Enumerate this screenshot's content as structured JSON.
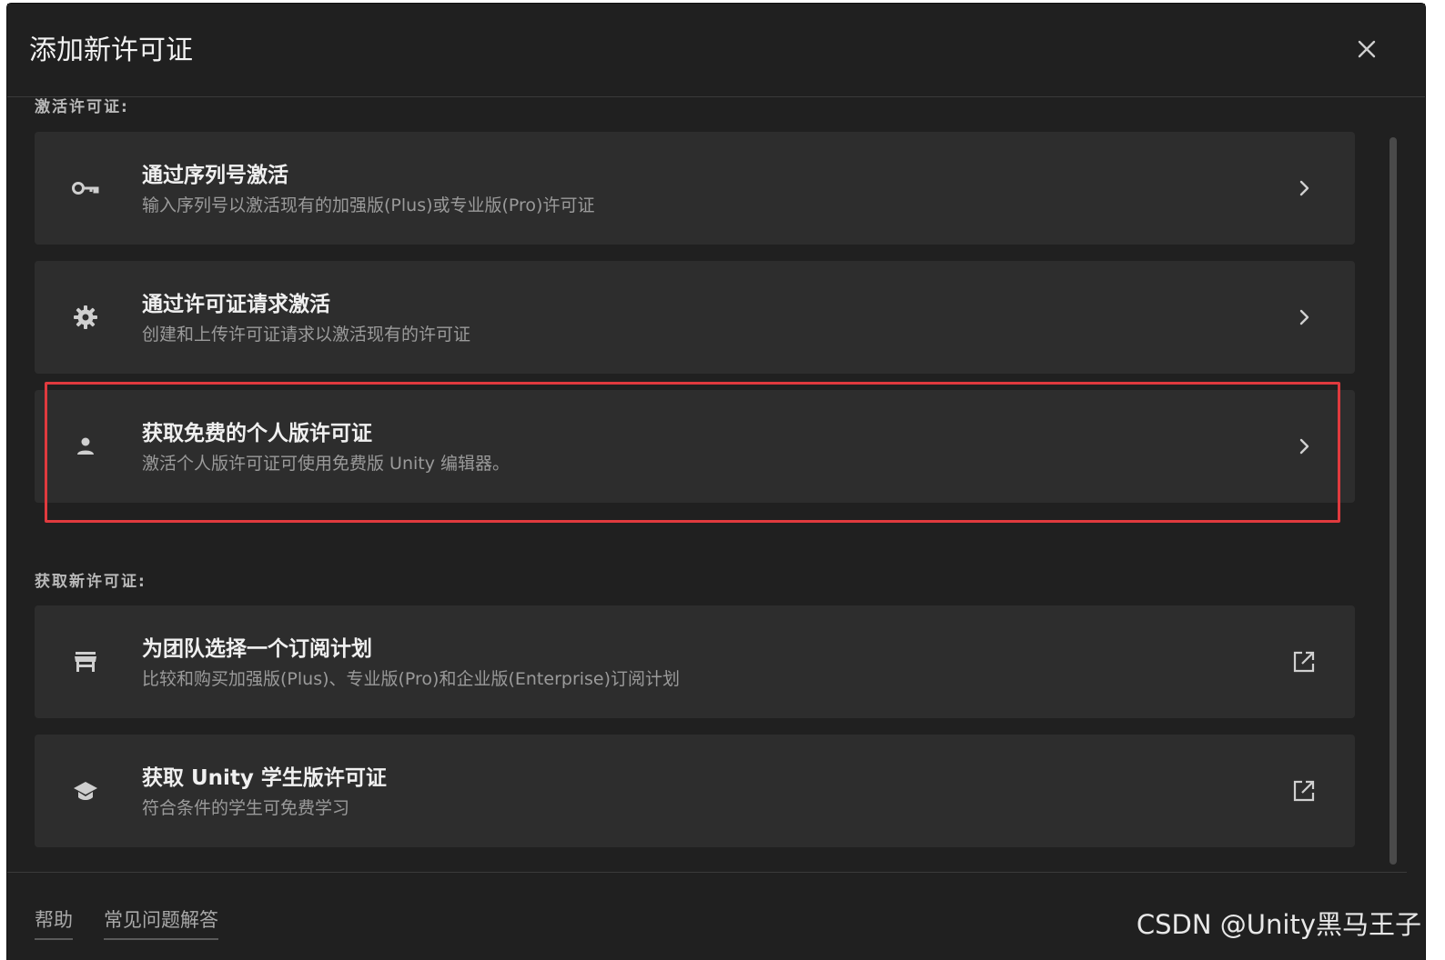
{
  "dialog": {
    "title": "添加新许可证",
    "close_icon": "close-icon"
  },
  "sections": {
    "activate_label": "激活许可证:",
    "new_label": "获取新许可证:"
  },
  "cards": [
    {
      "icon": "key-icon",
      "title": "通过序列号激活",
      "description": "输入序列号以激活现有的加强版(Plus)或专业版(Pro)许可证",
      "action_icon": "chevron-right-icon"
    },
    {
      "icon": "gear-icon",
      "title": "通过许可证请求激活",
      "description": "创建和上传许可证请求以激活现有的许可证",
      "action_icon": "chevron-right-icon"
    },
    {
      "icon": "person-icon",
      "title": "获取免费的个人版许可证",
      "description": "激活个人版许可证可使用免费版 Unity 编辑器。",
      "action_icon": "chevron-right-icon"
    },
    {
      "icon": "store-icon",
      "title": "为团队选择一个订阅计划",
      "description": "比较和购买加强版(Plus)、专业版(Pro)和企业版(Enterprise)订阅计划",
      "action_icon": "external-link-icon"
    },
    {
      "icon": "graduation-cap-icon",
      "title": "获取 Unity 学生版许可证",
      "description": "符合条件的学生可免费学习",
      "action_icon": "external-link-icon"
    }
  ],
  "footer": {
    "help": "帮助",
    "faq": "常见问题解答"
  },
  "watermark": "CSDN @Unity黑马王子",
  "colors": {
    "dialog_bg": "#202020",
    "card_bg": "#2d2d2d",
    "highlight": "#e03a3e"
  }
}
